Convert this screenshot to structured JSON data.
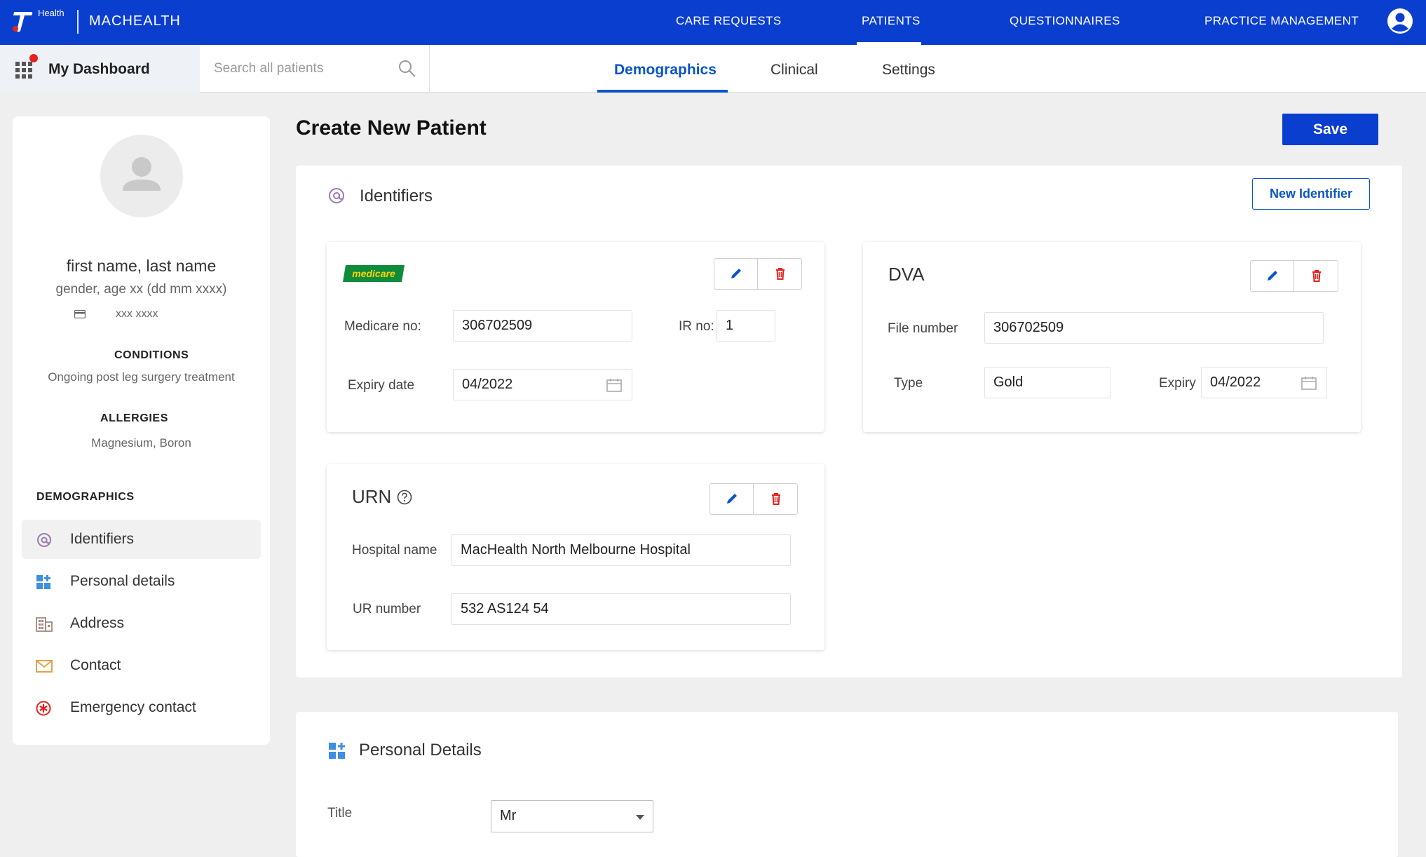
{
  "app": {
    "brand_small": "Health",
    "name": "MACHEALTH"
  },
  "top_nav": [
    {
      "label": "CARE REQUESTS"
    },
    {
      "label": "PATIENTS"
    },
    {
      "label": "QUESTIONNAIRES"
    },
    {
      "label": "PRACTICE MANAGEMENT"
    }
  ],
  "sub_nav": {
    "dashboard_label": "My Dashboard",
    "search_placeholder": "Search all patients",
    "tabs": [
      {
        "label": "Demographics"
      },
      {
        "label": "Clinical"
      },
      {
        "label": "Settings"
      }
    ],
    "active_tab": "Demographics"
  },
  "sidebar": {
    "patient_name": "first name, last name",
    "patient_meta": "gender, age xx (dd mm xxxx)",
    "card_number": "xxx xxxx",
    "conditions_heading": "CONDITIONS",
    "conditions_text": "Ongoing post leg surgery treatment",
    "allergies_heading": "ALLERGIES",
    "allergies_text": "Magnesium, Boron",
    "demographics_heading": "DEMOGRAPHICS",
    "items": [
      {
        "label": "Identifiers",
        "icon": "at-icon"
      },
      {
        "label": "Personal details",
        "icon": "grid-plus-icon"
      },
      {
        "label": "Address",
        "icon": "building-icon"
      },
      {
        "label": "Contact",
        "icon": "envelope-icon"
      },
      {
        "label": "Emergency contact",
        "icon": "emergency-icon"
      }
    ]
  },
  "main": {
    "title": "Create New Patient",
    "save_label": "Save",
    "identifiers": {
      "title": "Identifiers",
      "new_identifier_label": "New Identifier",
      "medicare": {
        "logo_text": "medicare",
        "number_label": "Medicare no:",
        "number_value": "306702509",
        "ir_label": "IR no:",
        "ir_value": "1",
        "expiry_label": "Expiry date",
        "expiry_value": "04/2022"
      },
      "dva": {
        "title": "DVA",
        "file_label": "File number",
        "file_value": "306702509",
        "type_label": "Type",
        "type_value": "Gold",
        "expiry_label": "Expiry",
        "expiry_value": "04/2022"
      },
      "urn": {
        "title": "URN",
        "hospital_label": "Hospital name",
        "hospital_value": "MacHealth North Melbourne Hospital",
        "ur_label": "UR number",
        "ur_value": "532 AS124 54"
      }
    },
    "personal_details": {
      "title": "Personal Details",
      "title_label": "Title",
      "title_value": "Mr"
    }
  },
  "colors": {
    "brand_blue": "#0a3ecf",
    "link_blue": "#0a55c8",
    "delete_red": "#e42320",
    "identifier_purple": "#9b7bb0"
  }
}
